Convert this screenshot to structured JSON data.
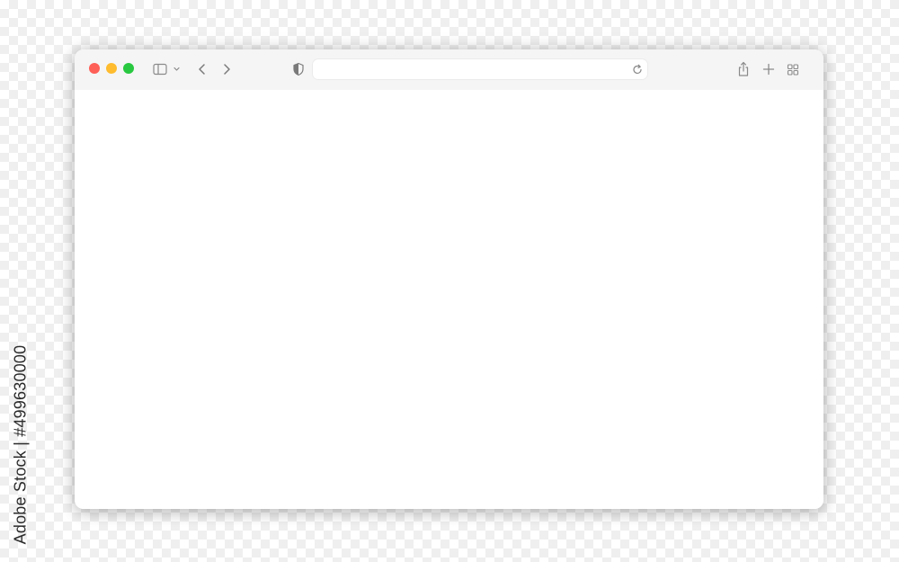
{
  "stock_id": "Adobe Stock | #499630000",
  "colors": {
    "close": "#fe5f57",
    "minimize": "#febc2e",
    "zoom": "#28c840",
    "toolbar_bg": "#f5f5f5",
    "icon": "#8a8a8a"
  },
  "icons": {
    "sidebar": "sidebar-icon",
    "back": "chevron-left-icon",
    "forward": "chevron-right-icon",
    "privacy": "half-shield-icon",
    "reload": "reload-icon",
    "share": "share-icon",
    "new_tab": "plus-icon",
    "tab_overview": "grid-icon"
  },
  "address_bar": {
    "value": "",
    "placeholder": ""
  }
}
